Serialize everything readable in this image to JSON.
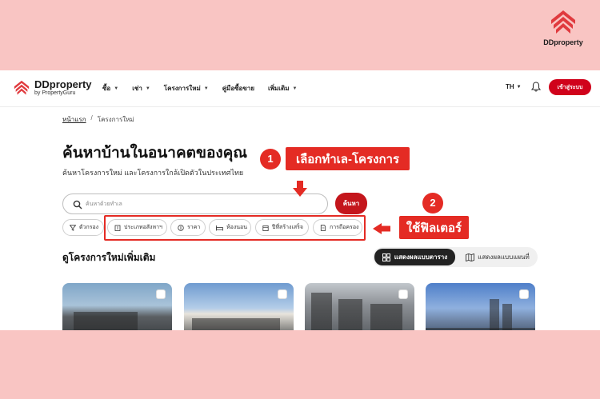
{
  "brand": {
    "corner_name": "DDproperty",
    "logo_name": "DDproperty",
    "logo_sub": "by PropertyGuru",
    "accent": "#d0021b"
  },
  "nav": {
    "items": [
      {
        "label": "ซื้อ",
        "has_dropdown": true
      },
      {
        "label": "เช่า",
        "has_dropdown": true
      },
      {
        "label": "โครงการใหม่",
        "has_dropdown": true
      },
      {
        "label": "คู่มือซื้อขาย",
        "has_dropdown": false
      },
      {
        "label": "เพิ่มเติม",
        "has_dropdown": true
      }
    ],
    "lang": "TH",
    "login_label": "เข้าสู่ระบบ"
  },
  "breadcrumb": {
    "home": "หน้าแรก",
    "separator": "/",
    "current": "โครงการใหม่"
  },
  "hero": {
    "title": "ค้นหาบ้านในอนาคตของคุณ",
    "subtitle": "ค้นหาโครงการใหม่ และโครงการใกล้เปิดตัวในประเทศไทย"
  },
  "search": {
    "placeholder": "ค้นหาด้วยทำเล",
    "value": "",
    "button": "ค้นหา"
  },
  "filters": {
    "main": "ตัวกรอง",
    "chips": [
      "ประเภทอสังหาฯ",
      "ราคา",
      "ห้องนอน",
      "ปีที่สร้างเสร็จ",
      "การถือครอง"
    ]
  },
  "section": {
    "title": "ดูโครงการใหม่เพิ่มเติม"
  },
  "view_toggle": {
    "table": "แสดงผลแบบตาราง",
    "map": "แสดงผลแบบแผนที่"
  },
  "annotations": {
    "step1_number": "1",
    "step1_text": "เลือกทำเล-โครงการ",
    "step2_number": "2",
    "step2_text": "ใช้ฟิลเตอร์",
    "color": "#e42b24"
  },
  "icons": [
    "ddproperty-logo-icon",
    "search-icon",
    "bell-icon",
    "filter-icon",
    "building-icon",
    "price-icon",
    "bed-icon",
    "calendar-icon",
    "document-icon",
    "grid-icon",
    "map-icon"
  ]
}
